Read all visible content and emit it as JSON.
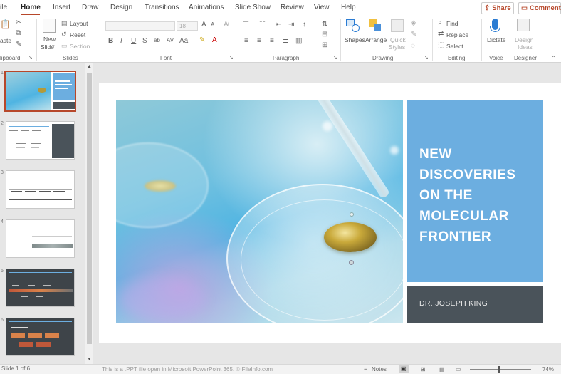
{
  "tabs": [
    {
      "label": "ile"
    },
    {
      "label": "Home"
    },
    {
      "label": "Insert"
    },
    {
      "label": "Draw"
    },
    {
      "label": "Design"
    },
    {
      "label": "Transitions"
    },
    {
      "label": "Animations"
    },
    {
      "label": "Slide Show"
    },
    {
      "label": "Review"
    },
    {
      "label": "View"
    },
    {
      "label": "Help"
    }
  ],
  "actions": {
    "share": "Share",
    "comments": "Comments"
  },
  "ribbon": {
    "clipboard": {
      "paste": "aste",
      "label": "lipboard"
    },
    "slides": {
      "new_slide_line1": "New",
      "new_slide_line2": "Slide",
      "layout": "Layout",
      "reset": "Reset",
      "section": "Section",
      "label": "Slides"
    },
    "font": {
      "size": "18",
      "label": "Font",
      "bold": "B",
      "italic": "I",
      "underline": "U",
      "strike": "S",
      "spacing": "AV",
      "case": "Aa",
      "grow": "A",
      "shrink": "A"
    },
    "paragraph": {
      "label": "Paragraph"
    },
    "drawing": {
      "shapes": "Shapes",
      "arrange": "Arrange",
      "quick_styles_1": "Quick",
      "quick_styles_2": "Styles",
      "label": "Drawing"
    },
    "editing": {
      "find": "Find",
      "replace": "Replace",
      "select": "Select",
      "label": "Editing"
    },
    "voice": {
      "dictate": "Dictate",
      "label": "Voice"
    },
    "designer": {
      "ideas_1": "Design",
      "ideas_2": "Ideas",
      "label": "Designer"
    }
  },
  "slide_numbers": [
    "1",
    "2",
    "3",
    "4",
    "5",
    "6"
  ],
  "slide": {
    "title": "NEW DISCOVERIES ON THE MOLECULAR FRONTIER",
    "author": "DR. JOSEPH KING"
  },
  "status": {
    "slide_of": "Slide 1 of 6",
    "message": "This is a .PPT file open in Microsoft PowerPoint 365. © FileInfo.com",
    "notes": "Notes",
    "zoom": "74%"
  },
  "colors": {
    "accent": "#b7472a",
    "title_panel": "#6caee0",
    "author_panel": "#4a535a"
  }
}
